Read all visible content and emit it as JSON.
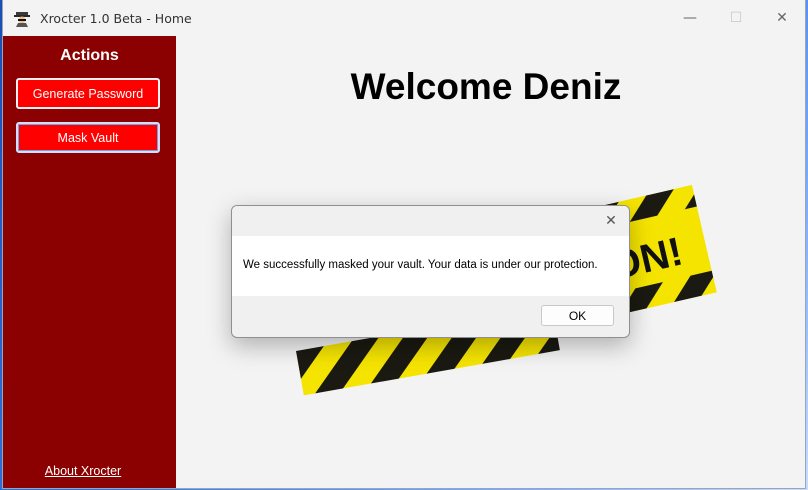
{
  "window": {
    "title": "Xrocter 1.0 Beta - Home",
    "app_icon": "spy-icon",
    "controls": {
      "minimize": "—",
      "maximize": "☐",
      "close": "✕"
    }
  },
  "sidebar": {
    "heading": "Actions",
    "buttons": [
      {
        "label": "Generate Password"
      },
      {
        "label": "Mask Vault"
      }
    ],
    "about_link": "About Xrocter",
    "background_color": "#8b0000",
    "button_color": "#ff0000"
  },
  "main": {
    "welcome_text": "Welcome Deniz",
    "caution_banner_text": "ON!"
  },
  "dialog": {
    "message": "We successfully masked your vault. Your data is under our protection.",
    "ok_label": "OK",
    "close_glyph": "✕"
  }
}
